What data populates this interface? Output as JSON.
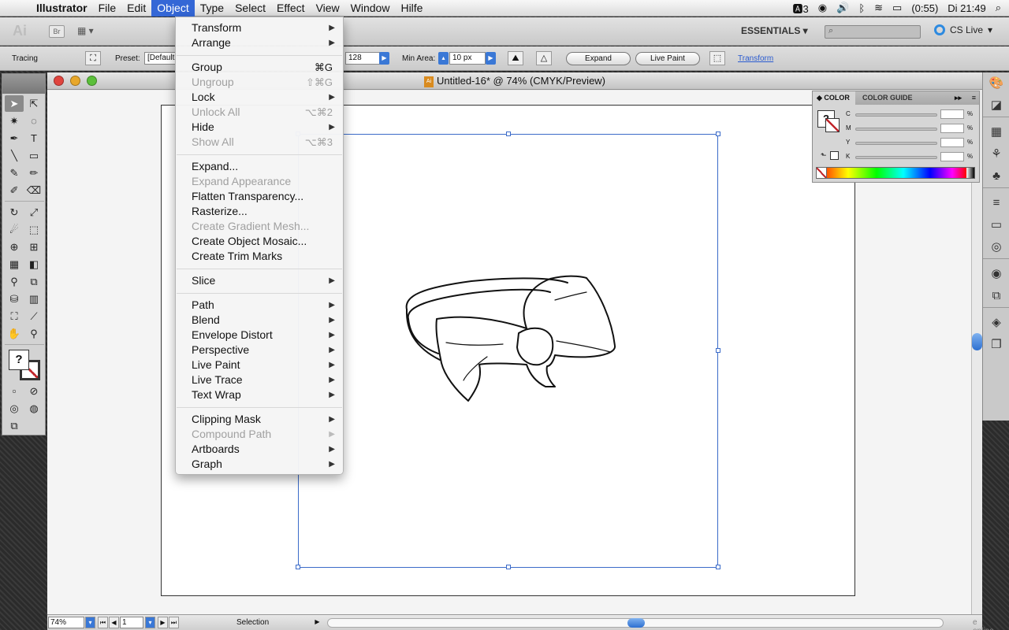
{
  "menubar": {
    "app": "Illustrator",
    "items": [
      "File",
      "Edit",
      "Object",
      "Type",
      "Select",
      "Effect",
      "View",
      "Window",
      "Hilfe"
    ],
    "active": "Object",
    "adobe_badge": "3",
    "battery": "(0:55)",
    "clock": "Di 21:49"
  },
  "appbar": {
    "logo": "Ai",
    "bridge": "Br",
    "workspace": "ESSENTIALS ▾",
    "cs_live": "CS Live"
  },
  "control": {
    "label": "Tracing",
    "preset_label": "Preset:",
    "preset_value": "[Default",
    "threshold_value": "128",
    "min_area_label": "Min Area:",
    "min_area_value": "10 px",
    "expand": "Expand",
    "live_paint": "Live Paint",
    "transform": "Transform"
  },
  "document": {
    "title": "Untitled-16* @ 74% (CMYK/Preview)"
  },
  "status": {
    "zoom": "74%",
    "page": "1",
    "tool": "Selection",
    "corner": "e online"
  },
  "object_menu": {
    "groups": [
      [
        {
          "label": "Transform",
          "submenu": true
        },
        {
          "label": "Arrange",
          "submenu": true
        }
      ],
      [
        {
          "label": "Group",
          "shortcut": "⌘G"
        },
        {
          "label": "Ungroup",
          "shortcut": "⇧⌘G",
          "disabled": true
        },
        {
          "label": "Lock",
          "submenu": true
        },
        {
          "label": "Unlock All",
          "shortcut": "⌥⌘2",
          "disabled": true
        },
        {
          "label": "Hide",
          "submenu": true
        },
        {
          "label": "Show All",
          "shortcut": "⌥⌘3",
          "disabled": true
        }
      ],
      [
        {
          "label": "Expand..."
        },
        {
          "label": "Expand Appearance",
          "disabled": true
        },
        {
          "label": "Flatten Transparency..."
        },
        {
          "label": "Rasterize..."
        },
        {
          "label": "Create Gradient Mesh...",
          "disabled": true
        },
        {
          "label": "Create Object Mosaic..."
        },
        {
          "label": "Create Trim Marks"
        }
      ],
      [
        {
          "label": "Slice",
          "submenu": true
        }
      ],
      [
        {
          "label": "Path",
          "submenu": true
        },
        {
          "label": "Blend",
          "submenu": true
        },
        {
          "label": "Envelope Distort",
          "submenu": true
        },
        {
          "label": "Perspective",
          "submenu": true
        },
        {
          "label": "Live Paint",
          "submenu": true
        },
        {
          "label": "Live Trace",
          "submenu": true
        },
        {
          "label": "Text Wrap",
          "submenu": true
        }
      ],
      [
        {
          "label": "Clipping Mask",
          "submenu": true
        },
        {
          "label": "Compound Path",
          "submenu": true,
          "disabled": true
        },
        {
          "label": "Artboards",
          "submenu": true
        },
        {
          "label": "Graph",
          "submenu": true
        }
      ]
    ]
  },
  "color_panel": {
    "tab_active": "COLOR",
    "tab_other": "COLOR GUIDE",
    "channels": [
      "C",
      "M",
      "Y",
      "K"
    ],
    "percent": "%"
  },
  "colors": {
    "menu_highlight": "#3467d6",
    "selection_blue": "#3b6bc9",
    "none_red": "#c0262c"
  }
}
